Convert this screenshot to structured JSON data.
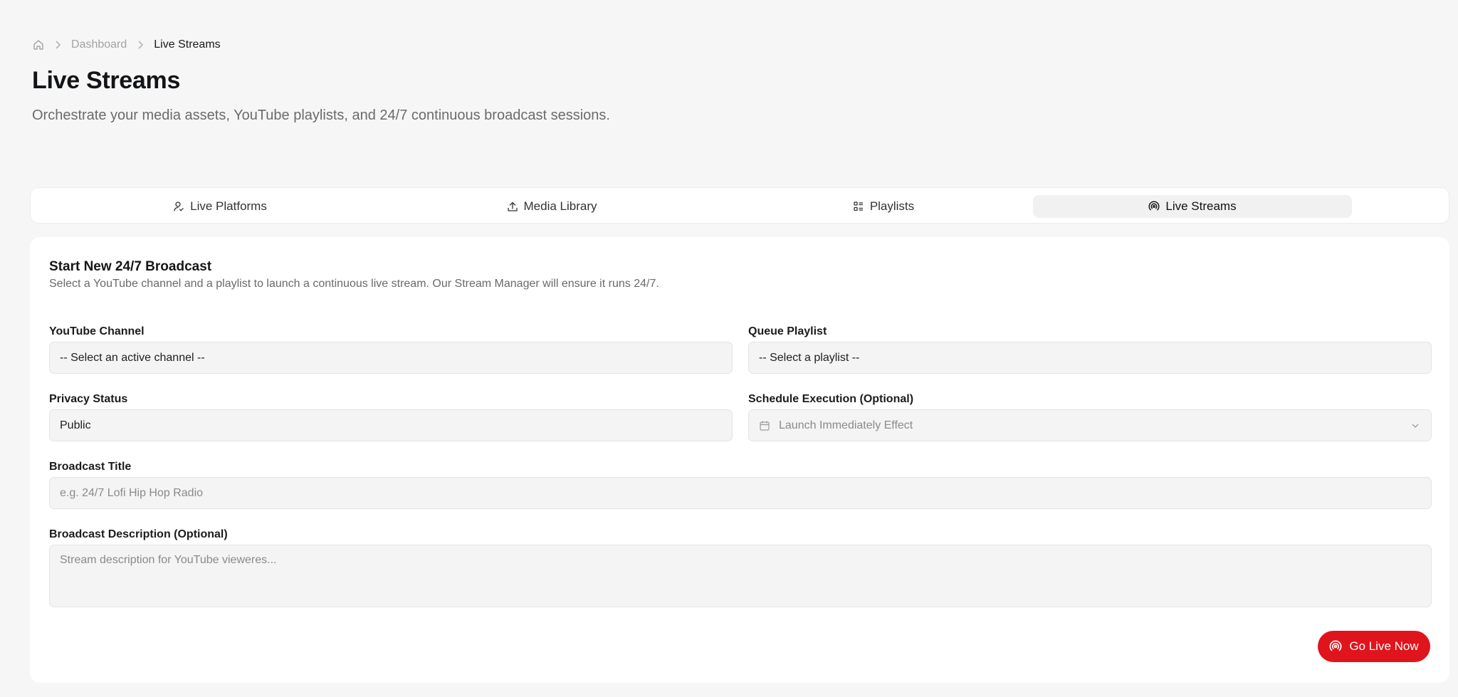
{
  "breadcrumb": {
    "home_icon": "home-icon",
    "items": [
      "Dashboard",
      "Live Streams"
    ]
  },
  "header": {
    "title": "Live Streams",
    "subtitle": "Orchestrate your media assets, YouTube playlists, and 24/7 continuous broadcast sessions."
  },
  "tabs": [
    {
      "label": "Live Platforms",
      "icon": "user-check-icon",
      "active": false
    },
    {
      "label": "Media Library",
      "icon": "upload-icon",
      "active": false
    },
    {
      "label": "Playlists",
      "icon": "list-icon",
      "active": false
    },
    {
      "label": "Live Streams",
      "icon": "broadcast-icon",
      "active": true
    }
  ],
  "form": {
    "title": "Start New 24/7 Broadcast",
    "description": "Select a YouTube channel and a playlist to launch a continuous live stream. Our Stream Manager will ensure it runs 24/7.",
    "channel": {
      "label": "YouTube Channel",
      "value": "-- Select an active channel --"
    },
    "playlist": {
      "label": "Queue Playlist",
      "value": "-- Select a playlist --"
    },
    "privacy": {
      "label": "Privacy Status",
      "value": "Public"
    },
    "schedule": {
      "label": "Schedule Execution (Optional)",
      "value": "Launch Immediately Effect"
    },
    "title_field": {
      "label": "Broadcast Title",
      "placeholder": "e.g. 24/7 Lofi Hip Hop Radio"
    },
    "description_field": {
      "label": "Broadcast Description (Optional)",
      "placeholder": "Stream description for YouTube vieweres..."
    },
    "submit_label": "Go Live Now"
  },
  "colors": {
    "accent": "#e0141c",
    "background": "#f6f6f6",
    "card": "#ffffff"
  }
}
